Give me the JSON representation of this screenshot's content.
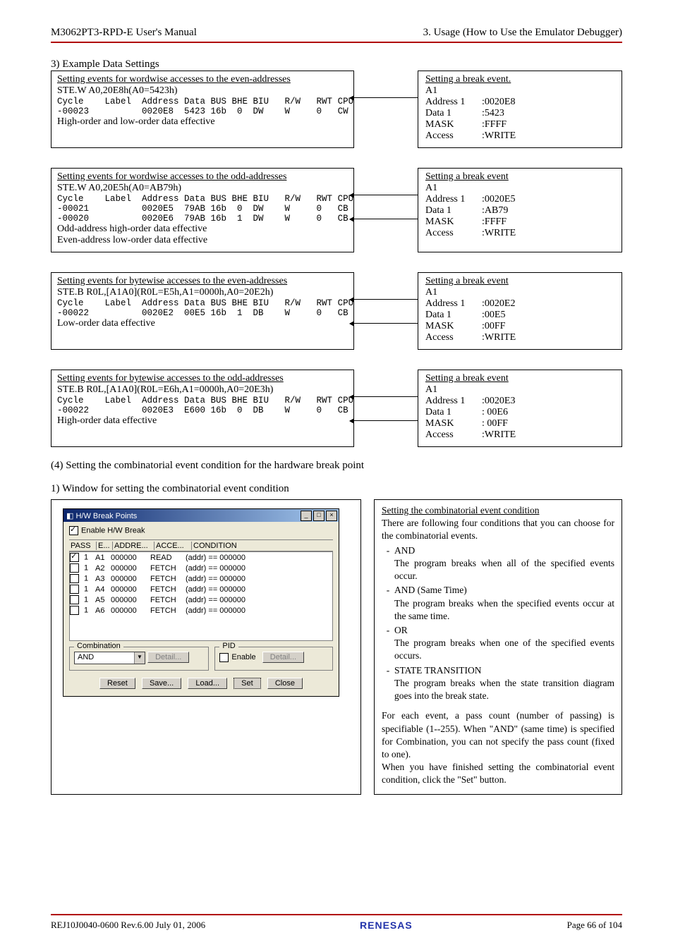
{
  "header": {
    "left": "M3062PT3-RPD-E User's Manual",
    "right": "3. Usage (How to Use the Emulator Debugger)"
  },
  "section3_title": "3) Example Data Settings",
  "examples": [
    {
      "left_title": "Setting events for wordwise accesses to the even-addresses",
      "left_sub": "STE.W A0,20E8h(A0=5423h)",
      "left_mono": "Cycle    Label  Address Data BUS BHE BIU   R/W   RWT CPU\n-00023          0020E8  5423 16b  0  DW    W     0   CW",
      "left_note": "High-order and low-order data effective",
      "right_title": "Setting a break event.",
      "right_kv": [
        [
          "A1",
          ""
        ],
        [
          "Address 1",
          ":0020E8"
        ],
        [
          "Data 1",
          ":5423"
        ],
        [
          "MASK",
          ":FFFF"
        ],
        [
          "Access",
          ":WRITE"
        ]
      ]
    },
    {
      "left_title": "Setting events for wordwise accesses to the odd-addresses",
      "left_sub": "STE.W A0,20E5h(A0=AB79h)",
      "left_mono": "Cycle    Label  Address Data BUS BHE BIU   R/W   RWT CPU\n-00021          0020E5  79AB 16b  0  DW    W     0   CB\n-00020          0020E6  79AB 16b  1  DW    W     0   CB",
      "left_note": "Odd-address high-order data effective\nEven-address low-order data effective",
      "right_title": "Setting a break event",
      "right_kv": [
        [
          "A1",
          ""
        ],
        [
          "Address 1",
          ":0020E5"
        ],
        [
          "Data 1",
          ":AB79"
        ],
        [
          "MASK",
          ":FFFF"
        ],
        [
          "Access",
          ":WRITE"
        ]
      ]
    },
    {
      "left_title": "Setting events for bytewise accesses to the even-addresses",
      "left_sub": "STE.B R0L,[A1A0](R0L=E5h,A1=0000h,A0=20E2h)",
      "left_mono": "Cycle    Label  Address Data BUS BHE BIU   R/W   RWT CPU\n-00022          0020E2  00E5 16b  1  DB    W     0   CB",
      "left_note": "Low-order data effective",
      "right_title": "Setting a break event",
      "right_kv": [
        [
          "A1",
          ""
        ],
        [
          "Address 1",
          ":0020E2"
        ],
        [
          "Data 1",
          ":00E5"
        ],
        [
          "MASK",
          ":00FF"
        ],
        [
          "Access",
          ":WRITE"
        ]
      ]
    },
    {
      "left_title": "Setting events for bytewise accesses to the odd-addresses",
      "left_sub": "STE.B R0L,[A1A0](R0L=E6h,A1=0000h,A0=20E3h)",
      "left_mono": "Cycle    Label  Address Data BUS BHE BIU   R/W   RWT CPU\n-00022          0020E3  E600 16b  0  DB    W     0   CB",
      "left_note": "High-order data effective",
      "right_title": "Setting a break event",
      "right_kv": [
        [
          "A1",
          ""
        ],
        [
          "Address 1",
          ":0020E3"
        ],
        [
          "Data 1",
          ": 00E6"
        ],
        [
          "MASK",
          ": 00FF"
        ],
        [
          "Access",
          ":WRITE"
        ]
      ]
    }
  ],
  "para4": "(4) Setting the combinatorial event condition for the hardware break point",
  "sub1": "1) Window for setting the combinatorial event condition",
  "dialog": {
    "title": "H/W Break Points",
    "enable_label": "Enable H/W Break",
    "cols": [
      "PASS",
      "E...",
      "ADDRE...",
      "ACCE...",
      "CONDITION"
    ],
    "rows": [
      {
        "chk": true,
        "e": "1",
        "a": "A1",
        "addr": "000000",
        "acc": "READ",
        "cond": "(addr) == 000000"
      },
      {
        "chk": false,
        "e": "1",
        "a": "A2",
        "addr": "000000",
        "acc": "FETCH",
        "cond": "(addr) == 000000"
      },
      {
        "chk": false,
        "e": "1",
        "a": "A3",
        "addr": "000000",
        "acc": "FETCH",
        "cond": "(addr) == 000000"
      },
      {
        "chk": false,
        "e": "1",
        "a": "A4",
        "addr": "000000",
        "acc": "FETCH",
        "cond": "(addr) == 000000"
      },
      {
        "chk": false,
        "e": "1",
        "a": "A5",
        "addr": "000000",
        "acc": "FETCH",
        "cond": "(addr) == 000000"
      },
      {
        "chk": false,
        "e": "1",
        "a": "A6",
        "addr": "000000",
        "acc": "FETCH",
        "cond": "(addr) == 000000"
      }
    ],
    "grp_comb": "Combination",
    "comb_value": "AND",
    "btn_detail": "Detail...",
    "grp_pid": "PID",
    "pid_enable": "Enable",
    "btn_reset": "Reset",
    "btn_save": "Save...",
    "btn_load": "Load...",
    "btn_set": "Set",
    "btn_close": "Close"
  },
  "right_panel": {
    "title": "Setting the combinatorial event condition",
    "intro": "There are following four conditions that you can choose for the combinatorial events.",
    "items": [
      {
        "h": "AND",
        "b": "The program breaks when all of the specified events occur."
      },
      {
        "h": "AND (Same Time)",
        "b": "The program breaks when the specified events occur at the same time."
      },
      {
        "h": "OR",
        "b": "The program breaks when one of the specified events occurs."
      },
      {
        "h": "STATE TRANSITION",
        "b": "The program breaks when the state transition diagram goes into the break state."
      }
    ],
    "foot1": "For each event, a pass count (number of passing) is specifiable (1--255). When \"AND\" (same time) is specified for Combination, you can not specify the pass count (fixed to one).",
    "foot2": "When you have finished setting the combinatorial event condition, click the \"Set\" button."
  },
  "footer": {
    "left": "REJ10J0040-0600  Rev.6.00  July  01, 2006",
    "logo": "RENESAS",
    "right": "Page  66  of  104"
  }
}
